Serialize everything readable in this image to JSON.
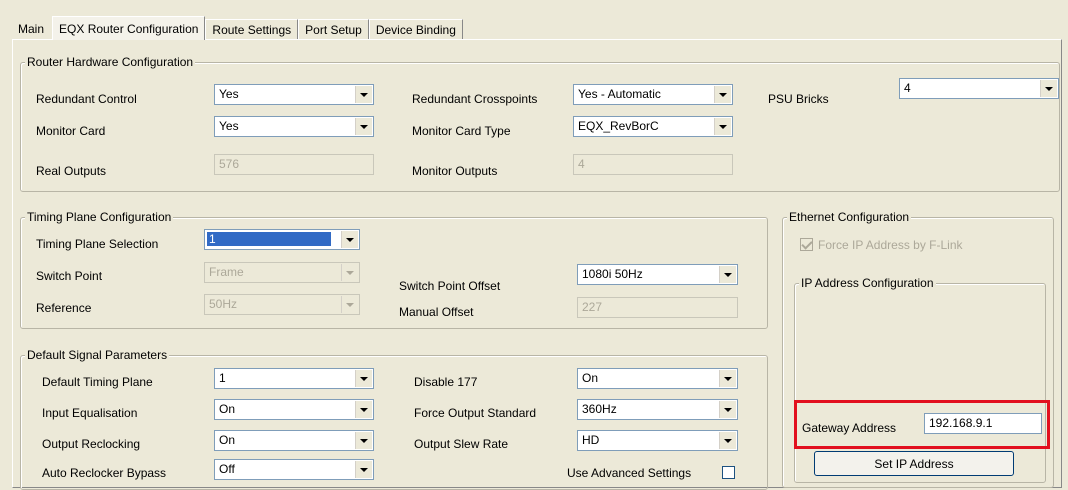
{
  "tabs": [
    {
      "label": "Main"
    },
    {
      "label": "EQX Router Configuration"
    },
    {
      "label": "Route Settings"
    },
    {
      "label": "Port Setup"
    },
    {
      "label": "Device Binding"
    }
  ],
  "router_hw": {
    "title": "Router Hardware Configuration",
    "redundant_control": {
      "label": "Redundant Control",
      "value": "Yes"
    },
    "monitor_card": {
      "label": "Monitor Card",
      "value": "Yes"
    },
    "real_outputs": {
      "label": "Real Outputs",
      "value": "576"
    },
    "redundant_crosspoints": {
      "label": "Redundant Crosspoints",
      "value": "Yes - Automatic"
    },
    "monitor_card_type": {
      "label": "Monitor Card Type",
      "value": "EQX_RevBorC"
    },
    "monitor_outputs": {
      "label": "Monitor Outputs",
      "value": "4"
    },
    "psu_bricks": {
      "label": "PSU Bricks",
      "value": "4"
    }
  },
  "timing": {
    "title": "Timing Plane Configuration",
    "selection": {
      "label": "Timing Plane Selection",
      "value": "1"
    },
    "switch_point": {
      "label": "Switch Point",
      "value": "Frame"
    },
    "reference": {
      "label": "Reference",
      "value": "50Hz"
    },
    "switch_point_offset": {
      "label": "Switch Point Offset",
      "value": "1080i 50Hz"
    },
    "manual_offset": {
      "label": "Manual Offset",
      "value": "227"
    }
  },
  "signal": {
    "title": "Default Signal Parameters",
    "default_timing_plane": {
      "label": "Default Timing Plane",
      "value": "1"
    },
    "input_equalisation": {
      "label": "Input Equalisation",
      "value": "On"
    },
    "output_reclocking": {
      "label": "Output Reclocking",
      "value": "On"
    },
    "auto_reclocker_bypass": {
      "label": "Auto Reclocker Bypass",
      "value": "Off"
    },
    "disable_177": {
      "label": "Disable 177",
      "value": "On"
    },
    "force_output_standard": {
      "label": "Force Output Standard",
      "value": "360Hz"
    },
    "output_slew_rate": {
      "label": "Output Slew Rate",
      "value": "HD"
    },
    "use_advanced": {
      "label": "Use Advanced Settings",
      "checked": false
    }
  },
  "ethernet": {
    "title": "Ethernet Configuration",
    "force_ip": {
      "label": "Force IP Address by F-Link",
      "checked": true
    },
    "ip_config_title": "IP Address Configuration",
    "gateway": {
      "label": "Gateway Address",
      "value": "192.168.9.1"
    },
    "set_ip_button": "Set IP Address"
  },
  "colors": {
    "highlight": "#e2101e",
    "selection": "#316ac5"
  }
}
